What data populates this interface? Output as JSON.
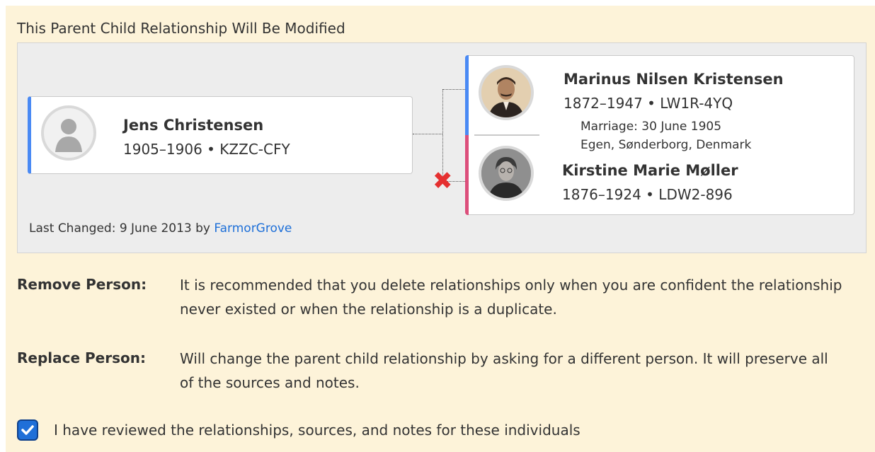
{
  "section_title": "This Parent Child Relationship Will Be Modified",
  "child": {
    "name": "Jens Christensen",
    "dates_id": "1905–1906 •  KZZC-CFY"
  },
  "father": {
    "name": "Marinus Nilsen Kristensen",
    "dates_id": "1872–1947 •  LW1R-4YQ"
  },
  "marriage": {
    "line1": "Marriage: 30 June 1905",
    "line2": "Egen, Sønderborg, Denmark"
  },
  "mother": {
    "name": "Kirstine Marie Møller",
    "dates_id": "1876–1924 •  LDW2-896"
  },
  "last_changed": {
    "prefix": "Last Changed: 9 June 2013 by",
    "user": "FarmorGrove"
  },
  "remove": {
    "label": "Remove Person:",
    "text": "It is recommended that you delete relationships only when you are confident the relationship never existed or when the relationship is a duplicate."
  },
  "replace": {
    "label": "Replace Person:",
    "text": "Will change the parent child relationship by asking for a different person. It will preserve all of the sources and notes."
  },
  "review": {
    "label": "I have reviewed the relationships, sources, and notes for these individuals",
    "checked": true
  },
  "colors": {
    "father_stripe": "#4a8af4",
    "mother_stripe": "#dc4f7b",
    "remove_mark": "#e53030",
    "link": "#1d6fd8",
    "panel_bg": "#fdf3d9"
  }
}
